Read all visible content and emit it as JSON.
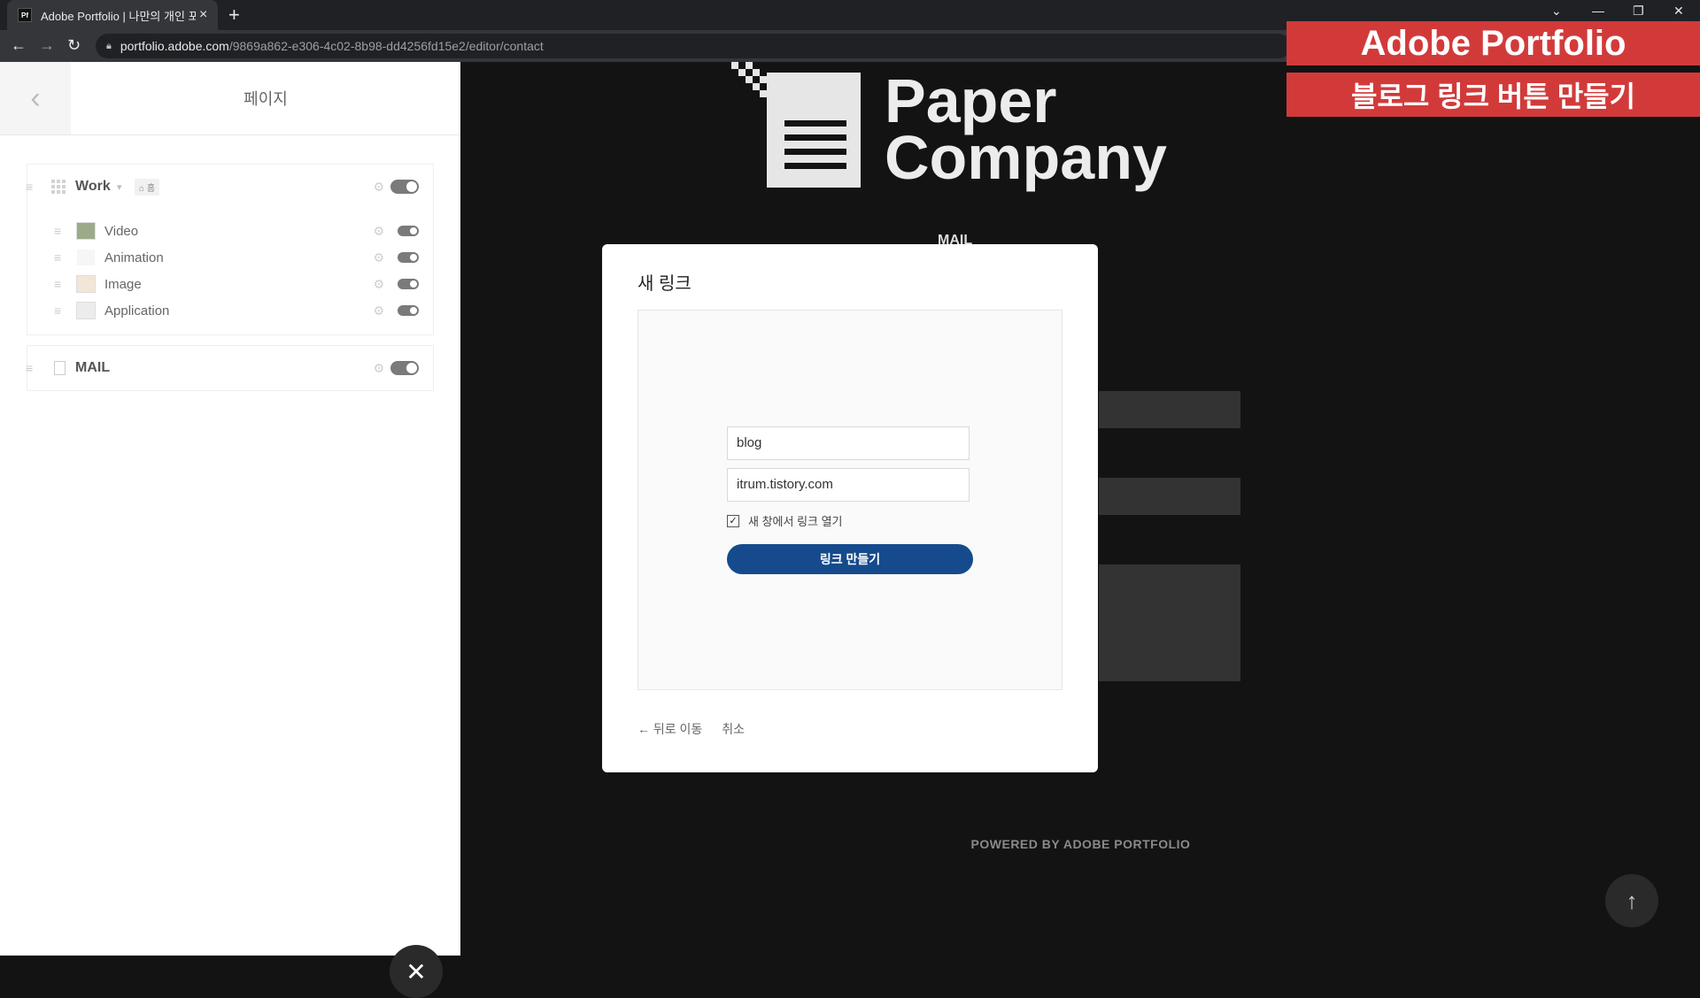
{
  "browser": {
    "tab_title": "Adobe Portfolio | 나만의 개인 포",
    "favicon_text": "Pf",
    "url_host": "portfolio.adobe.com",
    "url_path": "/9869a862-e306-4c02-8b98-dd4256fd15e2/editor/contact"
  },
  "sidebar": {
    "title": "페이지",
    "work": {
      "label": "Work",
      "badge": "홈"
    },
    "items": [
      {
        "label": "Video"
      },
      {
        "label": "Animation"
      },
      {
        "label": "Image"
      },
      {
        "label": "Application"
      }
    ],
    "mail": {
      "label": "MAIL"
    }
  },
  "preview": {
    "logo_line1": "Paper",
    "logo_line2": "Company",
    "section_title": "MAIL",
    "powered": "POWERED BY ADOBE PORTFOLIO"
  },
  "modal": {
    "title": "새 링크",
    "name_value": "blog",
    "url_value": "itrum.tistory.com",
    "checkbox_label": "새 창에서 링크 열기",
    "submit_label": "링크 만들기",
    "back_label": "← 뒤로 이동",
    "cancel_label": "취소"
  },
  "overlay": {
    "line1": "Adobe Portfolio",
    "line2": "블로그 링크 버튼 만들기"
  },
  "colors": {
    "submit": "#154b8c",
    "banner": "#d23a3a"
  }
}
